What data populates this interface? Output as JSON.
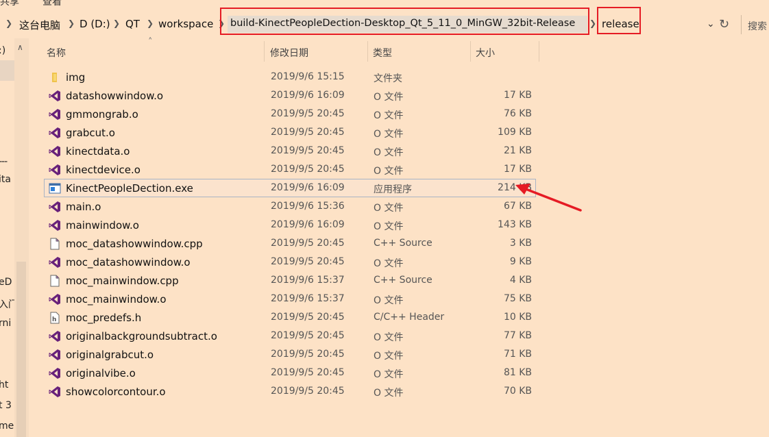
{
  "ribbon": {
    "tab_share": "共享",
    "tab_view": "查看"
  },
  "address_bar": {
    "crumbs": [
      "这台电脑",
      "D (D:)",
      "QT",
      "workspace",
      "build-KinectPeopleDection-Desktop_Qt_5_11_0_MinGW_32bit-Release",
      "release"
    ],
    "search_placeholder": "搜索"
  },
  "nav_pane": {
    "items": [
      ":)",
      "---",
      "ita",
      "eD",
      "入门",
      "rni",
      "ht",
      "t 3",
      "me"
    ]
  },
  "columns": {
    "name": "名称",
    "date": "修改日期",
    "type": "类型",
    "size": "大小"
  },
  "files": [
    {
      "name": "img",
      "date": "2019/9/6 15:15",
      "type": "文件夹",
      "size": "",
      "icon": "folder-icon"
    },
    {
      "name": "datashowwindow.o",
      "date": "2019/9/6 16:09",
      "type": "O 文件",
      "size": "17 KB",
      "icon": "vs-object-file-icon"
    },
    {
      "name": "gmmongrab.o",
      "date": "2019/9/5 20:45",
      "type": "O 文件",
      "size": "76 KB",
      "icon": "vs-object-file-icon"
    },
    {
      "name": "grabcut.o",
      "date": "2019/9/5 20:45",
      "type": "O 文件",
      "size": "109 KB",
      "icon": "vs-object-file-icon"
    },
    {
      "name": "kinectdata.o",
      "date": "2019/9/5 20:45",
      "type": "O 文件",
      "size": "21 KB",
      "icon": "vs-object-file-icon"
    },
    {
      "name": "kinectdevice.o",
      "date": "2019/9/5 20:45",
      "type": "O 文件",
      "size": "17 KB",
      "icon": "vs-object-file-icon"
    },
    {
      "name": "KinectPeopleDection.exe",
      "date": "2019/9/6 16:09",
      "type": "应用程序",
      "size": "214 KB",
      "icon": "exe-application-icon"
    },
    {
      "name": "main.o",
      "date": "2019/9/6 15:36",
      "type": "O 文件",
      "size": "67 KB",
      "icon": "vs-object-file-icon"
    },
    {
      "name": "mainwindow.o",
      "date": "2019/9/6 16:09",
      "type": "O 文件",
      "size": "143 KB",
      "icon": "vs-object-file-icon"
    },
    {
      "name": "moc_datashowwindow.cpp",
      "date": "2019/9/5 20:45",
      "type": "C++ Source",
      "size": "3 KB",
      "icon": "cpp-source-file-icon"
    },
    {
      "name": "moc_datashowwindow.o",
      "date": "2019/9/5 20:45",
      "type": "O 文件",
      "size": "9 KB",
      "icon": "vs-object-file-icon"
    },
    {
      "name": "moc_mainwindow.cpp",
      "date": "2019/9/6 15:37",
      "type": "C++ Source",
      "size": "4 KB",
      "icon": "cpp-source-file-icon"
    },
    {
      "name": "moc_mainwindow.o",
      "date": "2019/9/6 15:37",
      "type": "O 文件",
      "size": "75 KB",
      "icon": "vs-object-file-icon"
    },
    {
      "name": "moc_predefs.h",
      "date": "2019/9/5 20:45",
      "type": "C/C++ Header",
      "size": "10 KB",
      "icon": "header-file-icon"
    },
    {
      "name": "originalbackgroundsubtract.o",
      "date": "2019/9/5 20:45",
      "type": "O 文件",
      "size": "77 KB",
      "icon": "vs-object-file-icon"
    },
    {
      "name": "originalgrabcut.o",
      "date": "2019/9/5 20:45",
      "type": "O 文件",
      "size": "71 KB",
      "icon": "vs-object-file-icon"
    },
    {
      "name": "originalvibe.o",
      "date": "2019/9/5 20:45",
      "type": "O 文件",
      "size": "81 KB",
      "icon": "vs-object-file-icon"
    },
    {
      "name": "showcolorcontour.o",
      "date": "2019/9/5 20:45",
      "type": "O 文件",
      "size": "70 KB",
      "icon": "vs-object-file-icon"
    }
  ],
  "selected_file": "KinectPeopleDection.exe",
  "colors": {
    "background": "#fde2c6",
    "annotation_red": "#e51b24",
    "vs_purple": "#68217a"
  }
}
